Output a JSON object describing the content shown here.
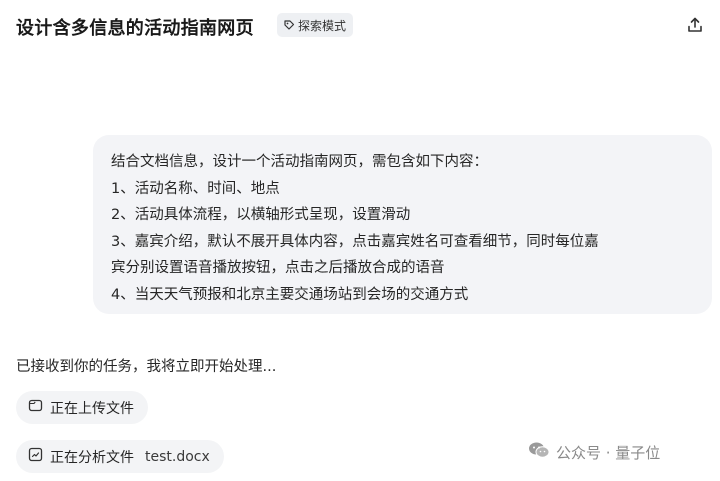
{
  "header": {
    "title": "设计含多信息的活动指南网页",
    "mode_label": "探索模式"
  },
  "user_message": {
    "lines": [
      "结合文档信息，设计一个活动指南网页，需包含如下内容：",
      "1、活动名称、时间、地点",
      "2、活动具体流程，以横轴形式呈现，设置滑动",
      "3、嘉宾介绍，默认不展开具体内容，点击嘉宾姓名可查看细节，同时每位嘉",
      "宾分别设置语音播放按钮，点击之后播放合成的语音",
      "4、当天天气预报和北京主要交通场站到会场的交通方式"
    ]
  },
  "assistant": {
    "reply": "已接收到你的任务，我将立即开始处理...",
    "steps": [
      {
        "label": "正在上传文件",
        "icon": "file-icon"
      },
      {
        "label": "正在分析文件",
        "icon": "analyze-file-icon",
        "filename": "test.docx"
      }
    ]
  },
  "watermark": {
    "text": "公众号 · 量子位"
  },
  "colors": {
    "bubble_bg": "#f3f4f7",
    "pill_bg": "#f3f4f6",
    "badge_bg": "#eef0f3",
    "text": "#262626",
    "muted": "#8a8a8a"
  }
}
